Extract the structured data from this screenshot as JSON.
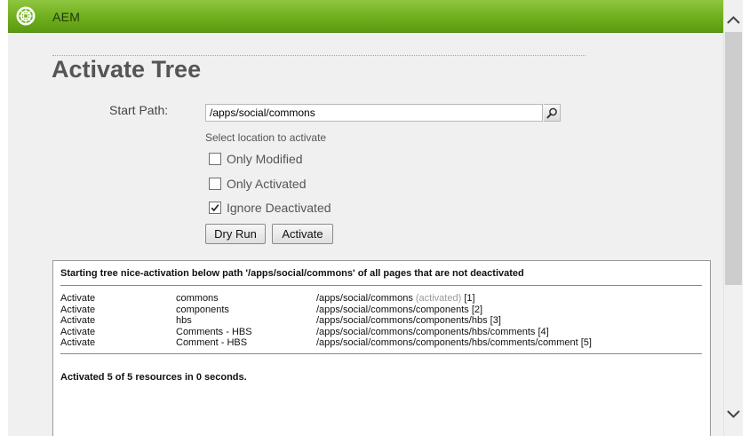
{
  "app": {
    "brand": "AEM",
    "accent_color": "#6fae1c",
    "logo_icon": "aem-logo-icon"
  },
  "page": {
    "title": "Activate Tree"
  },
  "form": {
    "start_path_label": "Start Path:",
    "start_path_value": "/apps/social/commons",
    "search_icon": "search-icon",
    "hint": "Select location to activate",
    "options": [
      {
        "label": "Only Modified",
        "checked": false
      },
      {
        "label": "Only Activated",
        "checked": false
      },
      {
        "label": "Ignore Deactivated",
        "checked": true
      }
    ],
    "buttons": {
      "dry_run": "Dry Run",
      "activate": "Activate"
    }
  },
  "results": {
    "header": "Starting tree nice-activation below path '/apps/social/commons' of all pages that are not deactivated",
    "rows": [
      {
        "action": "Activate",
        "title": "commons",
        "path": "/apps/social/commons",
        "status": "(activated)",
        "index": "[1]"
      },
      {
        "action": "Activate",
        "title": "components",
        "path": "/apps/social/commons/components",
        "status": "",
        "index": "[2]"
      },
      {
        "action": "Activate",
        "title": "hbs",
        "path": "/apps/social/commons/components/hbs",
        "status": "",
        "index": "[3]"
      },
      {
        "action": "Activate",
        "title": "Comments - HBS",
        "path": "/apps/social/commons/components/hbs/comments",
        "status": "",
        "index": "[4]"
      },
      {
        "action": "Activate",
        "title": "Comment - HBS",
        "path": "/apps/social/commons/components/hbs/comments/comment",
        "status": "",
        "index": "[5]"
      }
    ],
    "summary": "Activated 5 of 5 resources in 0 seconds."
  },
  "scrollbar": {
    "up_icon": "chevron-up-icon",
    "down_icon": "chevron-down-icon"
  }
}
